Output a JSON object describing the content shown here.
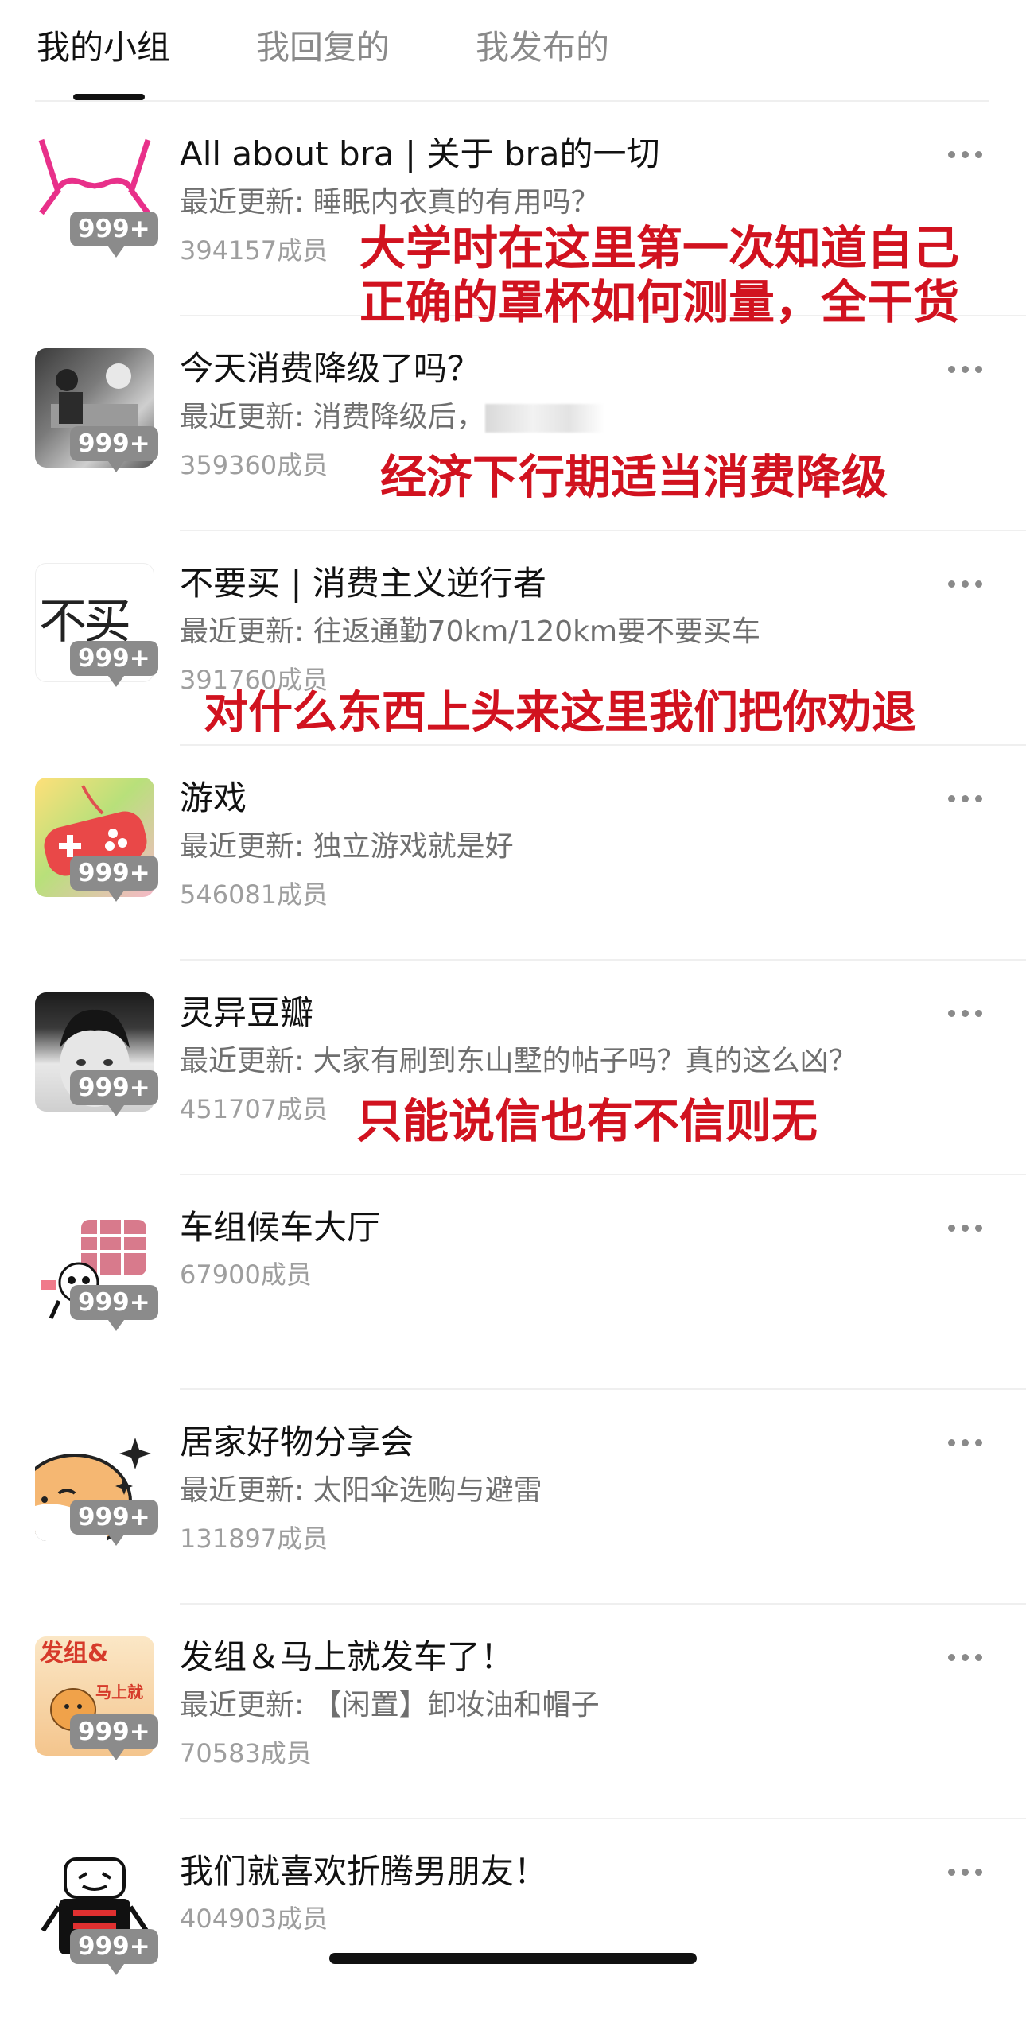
{
  "tabs": {
    "my_groups": "我的小组",
    "my_replies": "我回复的",
    "my_posts": "我发布的"
  },
  "badge_text": "999+",
  "groups": [
    {
      "name": "All about bra | 关于 bra的一切",
      "update_label": "最近更新: ",
      "update": "睡眠内衣真的有用吗？",
      "members": "394157成员",
      "avatar_icon": "bra-outline-icon"
    },
    {
      "name": "今天消费降级了吗？",
      "update_label": "最近更新: ",
      "update": "消费降级后，",
      "members": "359360成员",
      "avatar_icon": "old-photo-icon"
    },
    {
      "name": "不要买 | 消费主义逆行者",
      "update_label": "最近更新: ",
      "update": "往返通勤70km/120km要不要买车",
      "members": "391760成员",
      "avatar_text": "不买"
    },
    {
      "name": "游戏",
      "update_label": "最近更新: ",
      "update": "独立游戏就是好",
      "members": "546081成员",
      "avatar_icon": "gamepad-icon"
    },
    {
      "name": "灵异豆瓣",
      "update_label": "最近更新: ",
      "update": "大家有刷到东山墅的帖子吗？真的这么凶？",
      "members": "451707成员",
      "avatar_icon": "child-portrait-icon"
    },
    {
      "name": "车组候车大厅",
      "members": "67900成员",
      "avatar_icon": "panda-meme-icon"
    },
    {
      "name": "居家好物分享会",
      "update_label": "最近更新: ",
      "update": "太阳伞选购与避雷",
      "members": "131897成员",
      "avatar_icon": "cartoon-cat-icon"
    },
    {
      "name": "发组＆马上就发车了！",
      "update_label": "最近更新: ",
      "update": "【闲置】卸妆油和帽子",
      "members": "70583成员",
      "avatar_text_top": "发组&",
      "avatar_text_bottom": "马上就"
    },
    {
      "name": "我们就喜欢折腾男朋友！",
      "members": "404903成员",
      "avatar_icon": "cartoon-character-icon"
    }
  ],
  "annotations": {
    "a1_line1": "大学时在这里第一次知道自己",
    "a1_line2": "正确的罩杯如何测量，全干货",
    "a2": "经济下行期适当消费降级",
    "a3": "对什么东西上头来这里我们把你劝退",
    "a4": "只能说信也有不信则无"
  },
  "colors": {
    "annotation_red": "#d1121f",
    "badge_gray": "#8b8b8b",
    "secondary_text": "#6f6f6f",
    "members_text": "#9e9e9e"
  }
}
